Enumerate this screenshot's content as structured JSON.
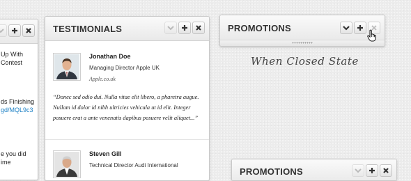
{
  "left_widget": {
    "lines": [
      "Up With",
      "Contest",
      "ds Finishing",
      "gd/MQL9c3",
      "e you did",
      "ime"
    ],
    "link_color": "#1a7fc4"
  },
  "testimonials": {
    "title": "TESTIMONIALS",
    "items": [
      {
        "name": "Jonathan Doe",
        "role": "Managing Director Apple UK",
        "site": "Apple.co.uk",
        "quote": "“Donec sed odio dui. Nulla vitae elit libero, a pharetra augue. Nullam id dolor id nibh ultricies vehicula ut id elit. Integer posuere erat a ante venenatis dapibus posuere velit aliquet...”"
      },
      {
        "name": "Steven Gill",
        "role": "Technical Director Audi International"
      }
    ]
  },
  "promotions_closed": {
    "title": "PROMOTIONS",
    "caption": "When Closed State"
  },
  "promotions_bottom": {
    "title": "PROMOTIONS"
  },
  "icons": [
    "chevron-down-icon",
    "plus-icon",
    "close-icon",
    "hand-cursor-icon",
    "grip-icon"
  ]
}
